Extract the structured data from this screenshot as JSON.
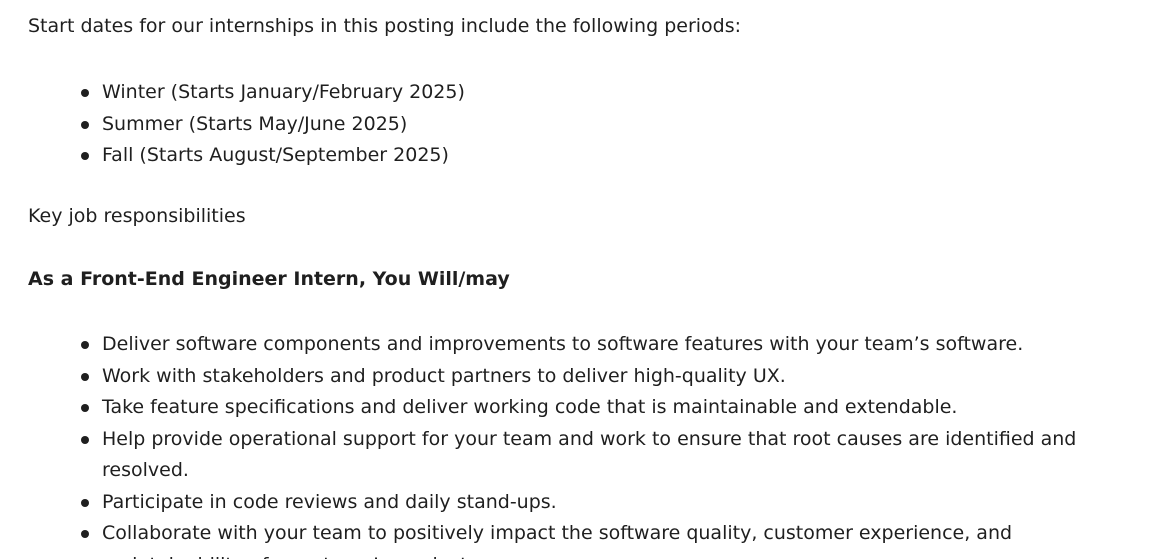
{
  "intro": "Start dates for our internships in this posting include the following periods:",
  "start_dates": [
    "Winter (Starts January/February 2025)",
    "Summer (Starts May/June 2025)",
    "Fall (Starts August/September 2025)"
  ],
  "responsibilities_heading": "Key job responsibilities",
  "role_heading": "As a Front-End Engineer Intern, You Will/may",
  "responsibilities": [
    "Deliver software components and improvements to software features with your team’s software.",
    "Work with stakeholders and product partners to deliver high-quality UX.",
    "Take feature specifications and deliver working code that is maintainable and extendable.",
    "Help provide operational support for your team and work to ensure that root causes are identified and resolved.",
    "Participate in code reviews and daily stand-ups.",
    "Collaborate with your team to positively impact the software quality, customer experience, and maintainability of your team’s products."
  ]
}
